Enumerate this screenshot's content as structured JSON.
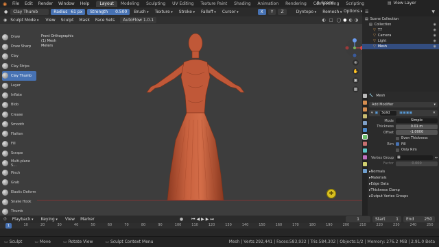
{
  "app": {
    "accent": "#4772b3",
    "logo_color": "#e8863a",
    "mesh_color": "#c0583a"
  },
  "menu": {
    "items": [
      "File",
      "Edit",
      "Render",
      "Window",
      "Help"
    ]
  },
  "workspaces": {
    "active": "Layout",
    "tabs": [
      "Layout",
      "Modeling",
      "Sculpting",
      "UV Editing",
      "Texture Paint",
      "Shading",
      "Animation",
      "Rendering",
      "Compositing",
      "Scripting"
    ]
  },
  "scene": {
    "scene_name": "Scene",
    "view_layer": "View Layer"
  },
  "tool_header": {
    "tool_name": "Clay Thumb",
    "radius_label": "Radius",
    "radius_value": "61 px",
    "strength_label": "Strength",
    "strength_value": "0.500",
    "menus": [
      "Brush",
      "Texture",
      "Stroke",
      "Falloff",
      "Cursor"
    ],
    "x_label": "X",
    "y_label": "Y",
    "z_label": "Z",
    "dyntopo": "Dyntopo",
    "remesh": "Remesh",
    "options": "Options"
  },
  "mode_header": {
    "mode": "Sculpt Mode",
    "menus": [
      "View",
      "Sculpt",
      "Mask",
      "Face Sets"
    ],
    "autoflow": "AutoFlow 1.0.1"
  },
  "tools": [
    "Draw",
    "Draw Sharp",
    "Clay",
    "Clay Strips",
    "Clay Thumb",
    "Layer",
    "Inflate",
    "Blob",
    "Crease",
    "Smooth",
    "Flatten",
    "Fill",
    "Scrape",
    "Multi-plane S...",
    "Pinch",
    "Grab",
    "Elastic Deform",
    "Snake Hook",
    "Thumb"
  ],
  "active_tool_index": 4,
  "viewport": {
    "view": "Front Orthographic",
    "object": "(1) Mesh",
    "units": "Meters"
  },
  "outliner": {
    "title": "Scene Collection",
    "rows": [
      {
        "name": "Collection",
        "selected": false
      },
      {
        "name": "T7",
        "selected": false
      },
      {
        "name": "Camera",
        "selected": false
      },
      {
        "name": "Light",
        "selected": false
      },
      {
        "name": "Mesh",
        "selected": true
      }
    ]
  },
  "properties": {
    "object": "Mesh",
    "add_modifier": "Add Modifier",
    "modifier_name": "Solid",
    "mode_label": "Mode",
    "mode_value": "Simple",
    "thickness_label": "Thickness",
    "thickness_value": "0.01 m",
    "offset_label": "Offset",
    "offset_value": "-1.0000",
    "even_thickness": "Even Thickness",
    "rim_label": "Rim",
    "fill_label": "Fill",
    "only_rim_label": "Only Rim",
    "vertex_group_label": "Vertex Group",
    "factor_label": "Factor",
    "factor_value": "0.000",
    "panels": [
      "Normals",
      "Materials",
      "Edge Data",
      "Thickness Clamp",
      "Output Vertex Groups"
    ],
    "tab_colors": [
      "#bbbbbb",
      "#d68e50",
      "#d68e50",
      "#c8bc70",
      "#7fa0c8",
      "#4b8bd0",
      "#6bbf6b",
      "#c87070",
      "#5ec8c8",
      "#c070c0",
      "#d0d070",
      "#70a0d0"
    ]
  },
  "timeline": {
    "menus": [
      "Playback",
      "Keying",
      "View",
      "Marker"
    ],
    "current_frame": "1",
    "start_label": "Start",
    "start_value": "1",
    "end_label": "End",
    "end_value": "250",
    "ticks": [
      "1",
      "10",
      "20",
      "30",
      "40",
      "50",
      "60",
      "70",
      "80",
      "90",
      "100",
      "110",
      "120",
      "130",
      "140",
      "150",
      "160",
      "170",
      "180",
      "190",
      "200",
      "210",
      "220",
      "230",
      "240",
      "250"
    ]
  },
  "statusbar": {
    "items": [
      "Sculpt",
      "Move",
      "Rotate View",
      "Sculpt Context Menu"
    ],
    "stats": "Mesh | Verts:292,441 | Faces:583,932 | Tris:584,302 | Objects:1/2 | Memory: 276.2 MiB | 2.91.0 Beta"
  }
}
